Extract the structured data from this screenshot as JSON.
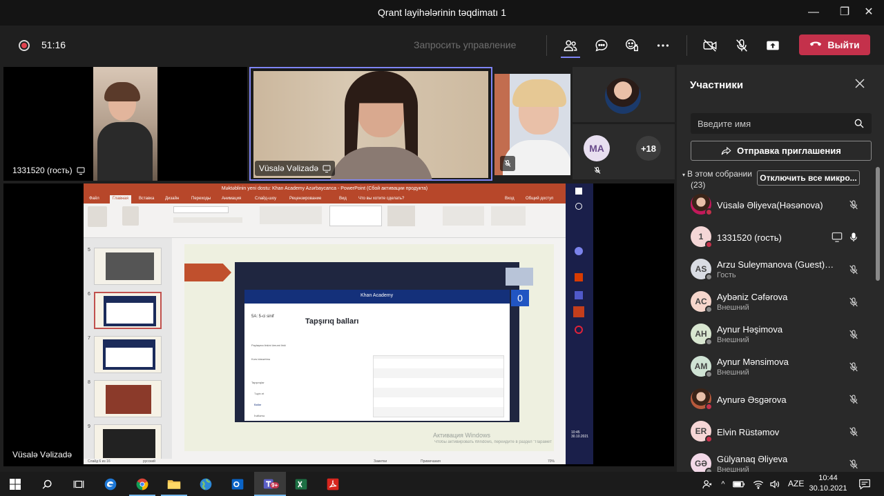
{
  "window": {
    "title": "Qrant layihələrinin təqdimatı 1",
    "minimize": "—",
    "maximize": "❐",
    "close": "✕"
  },
  "toolbar": {
    "timer": "51:16",
    "request_control": "Запросить управление",
    "leave_label": "Выйти"
  },
  "tiles": {
    "tile1_name": "1331520 (гость)",
    "tile2_name": "Vüsalə Vəlizadə",
    "avatar_initials": "MA",
    "more_count": "+18",
    "main_name": "Vüsalə Vəlizadə"
  },
  "ppt": {
    "title": "Məktəblinin yeni dostu: Khan Academy Azərbaycanca - PowerPoint (Сбой активации продукта)",
    "tabs": [
      "Файл",
      "Главная",
      "Вставка",
      "Дизайн",
      "Переходы",
      "Анимация",
      "Слайд-шоу",
      "Рецензирование",
      "Вид",
      "Что вы хотите сделать?"
    ],
    "share_label": "Общий доступ",
    "login_label": "Вход",
    "slide_numbers": [
      "5",
      "6",
      "7",
      "8",
      "9"
    ],
    "status_slide": "Слайд 6 из 16",
    "status_lang": "русский",
    "status_notes": "Заметки",
    "status_comments": "Примечания",
    "status_zoom": "70%",
    "khan_title": "Tapşırıq balları",
    "khan_logo": "Khan Academy",
    "khan_class": "5A: 5-ci sinif",
    "khan_sidebar": [
      "Paylaşma linkini ümumi linki",
      "Kurs idarəetmə",
      "Tapşırıqlar",
      "Təyin et",
      "Ballar",
      "İrəliləmə"
    ],
    "khan_counter": "0",
    "activation_line1": "Активация Windows",
    "activation_line2": "Чтобы активировать Windows, перейдите в раздел \"Параметры\"."
  },
  "panel": {
    "title": "Участники",
    "search_placeholder": "Введите имя",
    "invite_label": "Отправка приглашения",
    "in_meeting_label": "В этом собрании",
    "in_meeting_count": "(23)",
    "mute_all_label": "Отключить все микро...",
    "participants": [
      {
        "name": "Vüsalə Əliyeva(Həsənova)",
        "sub": "",
        "initials": "",
        "avatar_color": "#c2185b",
        "status": "busy"
      },
      {
        "name": "1331520 (гость)",
        "sub": "",
        "initials": "1",
        "avatar_color": "#f4d6d6",
        "status": "busy"
      },
      {
        "name": "Arzu Suleymanova (Guest) (ro...",
        "sub": "Гость",
        "initials": "AS",
        "avatar_color": "#d9dce3",
        "status": "offline"
      },
      {
        "name": "Aybəniz Cəfərova",
        "sub": "Внешний",
        "initials": "AC",
        "avatar_color": "#f6d6cc",
        "status": "offline"
      },
      {
        "name": "Aynur Həşimova",
        "sub": "Внешний",
        "initials": "AH",
        "avatar_color": "#d8e6d0",
        "status": "offline"
      },
      {
        "name": "Aynur Mənsimova",
        "sub": "Внешний",
        "initials": "AM",
        "avatar_color": "#cfe3d4",
        "status": "offline"
      },
      {
        "name": "Aynurə Əsgərova",
        "sub": "",
        "initials": "",
        "avatar_color": "#b85a3c",
        "status": "busy"
      },
      {
        "name": "Elvin Rüstəmov",
        "sub": "",
        "initials": "ER",
        "avatar_color": "#f6d6d6",
        "status": "busy"
      },
      {
        "name": "Gülyanaq Əliyeva",
        "sub": "Внешний",
        "initials": "GƏ",
        "avatar_color": "#f3d9e8",
        "status": "offline"
      }
    ]
  },
  "taskbar": {
    "language": "AZE",
    "time": "10:44",
    "date": "30.10.2021",
    "teams_badge": "9+"
  },
  "colors": {
    "leave": "#c4314b",
    "accent": "#7f85f5",
    "busy": "#c4314b",
    "ppt_red": "#b7472a"
  }
}
